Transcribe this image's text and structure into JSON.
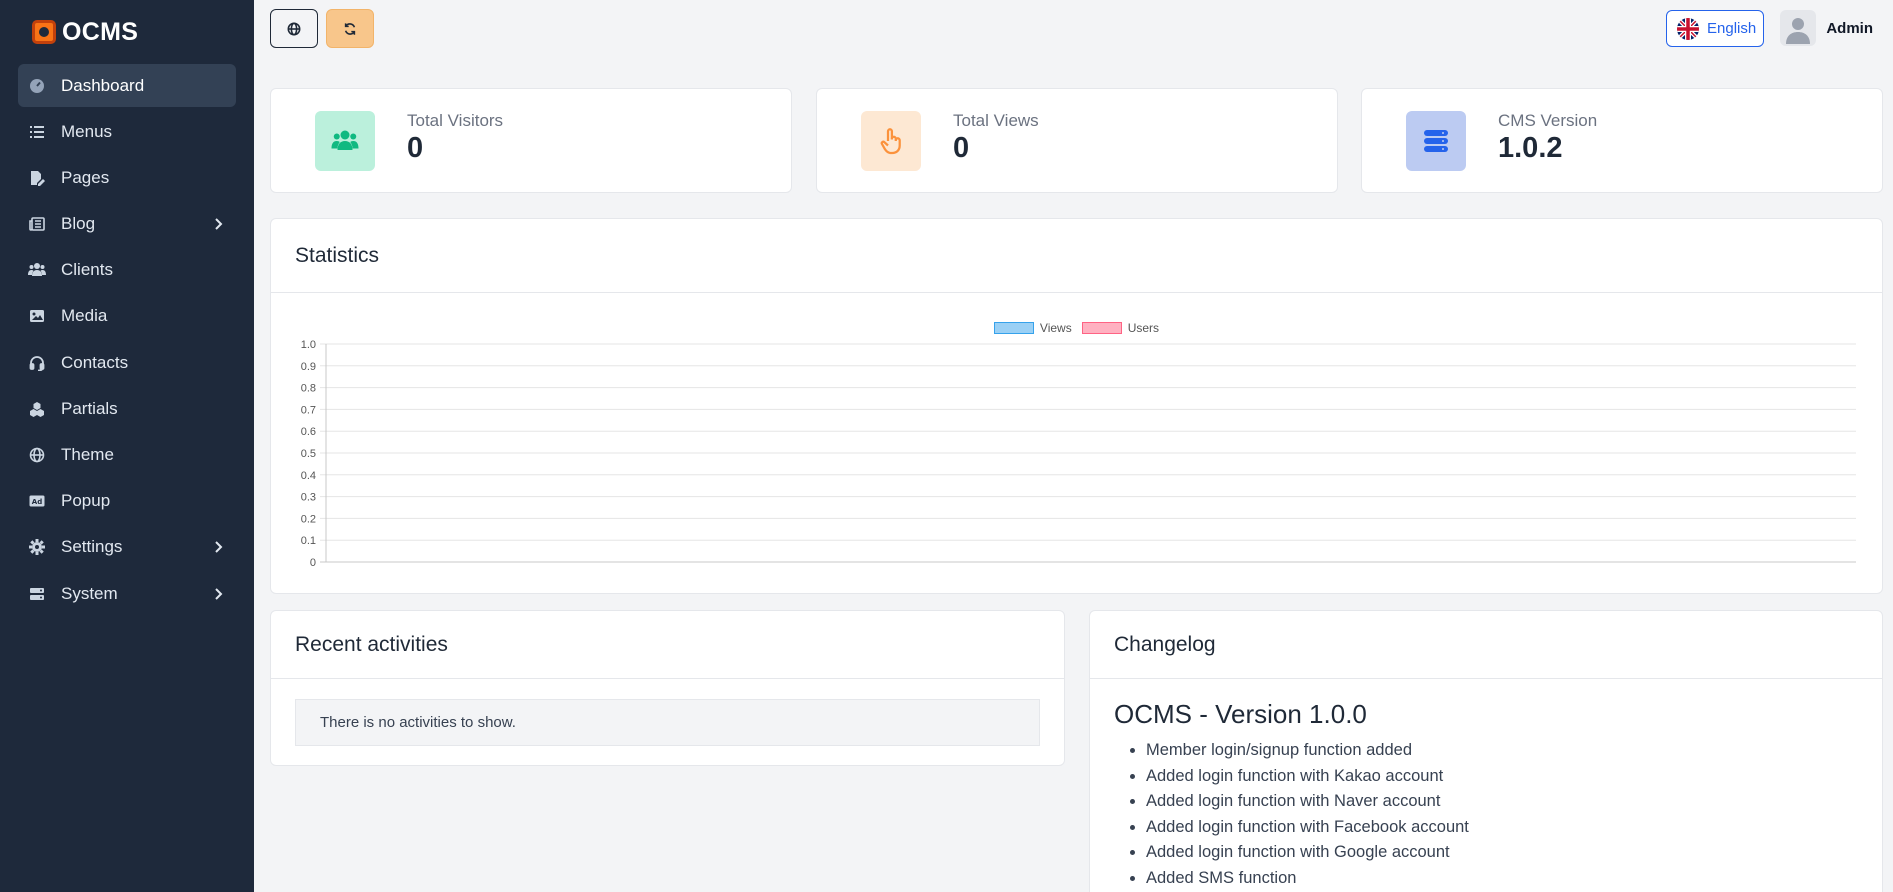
{
  "app": {
    "name": "OCMS"
  },
  "sidebar": {
    "items": [
      {
        "label": "Dashboard",
        "icon": "gauge-icon",
        "active": true,
        "has_children": false
      },
      {
        "label": "Menus",
        "icon": "list-icon",
        "active": false,
        "has_children": false
      },
      {
        "label": "Pages",
        "icon": "file-pen-icon",
        "active": false,
        "has_children": false
      },
      {
        "label": "Blog",
        "icon": "newspaper-icon",
        "active": false,
        "has_children": true
      },
      {
        "label": "Clients",
        "icon": "users-icon",
        "active": false,
        "has_children": false
      },
      {
        "label": "Media",
        "icon": "image-icon",
        "active": false,
        "has_children": false
      },
      {
        "label": "Contacts",
        "icon": "headset-icon",
        "active": false,
        "has_children": false
      },
      {
        "label": "Partials",
        "icon": "cubes-icon",
        "active": false,
        "has_children": false
      },
      {
        "label": "Theme",
        "icon": "globe-icon",
        "active": false,
        "has_children": false
      },
      {
        "label": "Popup",
        "icon": "rectangle-ad-icon",
        "active": false,
        "has_children": false
      },
      {
        "label": "Settings",
        "icon": "gear-icon",
        "active": false,
        "has_children": true
      },
      {
        "label": "System",
        "icon": "server-icon",
        "active": false,
        "has_children": true
      }
    ]
  },
  "topbar": {
    "language": "English",
    "user_name": "Admin"
  },
  "stats": [
    {
      "label": "Total Visitors",
      "value": "0",
      "icon": "users-icon",
      "color": "#34d399"
    },
    {
      "label": "Total Views",
      "value": "0",
      "icon": "hand-pointer-icon",
      "color": "#fb923c"
    },
    {
      "label": "CMS Version",
      "value": "1.0.2",
      "icon": "database-icon",
      "color": "#2563eb"
    }
  ],
  "statistics": {
    "title": "Statistics"
  },
  "chart_data": {
    "type": "line",
    "series": [
      {
        "name": "Views",
        "values": [],
        "color": "#9ad0f5"
      },
      {
        "name": "Users",
        "values": [],
        "color": "#ffb1c1"
      }
    ],
    "ylim": [
      0,
      1.0
    ],
    "y_ticks": [
      "1.0",
      "0.9",
      "0.8",
      "0.7",
      "0.6",
      "0.5",
      "0.4",
      "0.3",
      "0.2",
      "0.1",
      "0"
    ],
    "legend": "top-center",
    "grid": true
  },
  "recent": {
    "title": "Recent activities",
    "empty_text": "There is no activities to show."
  },
  "changelog": {
    "title": "Changelog",
    "version_title": "OCMS - Version 1.0.0",
    "items": [
      "Member login/signup function added",
      "Added login function with Kakao account",
      "Added login function with Naver account",
      "Added login function with Facebook account",
      "Added login function with Google account",
      "Added SMS function"
    ]
  }
}
